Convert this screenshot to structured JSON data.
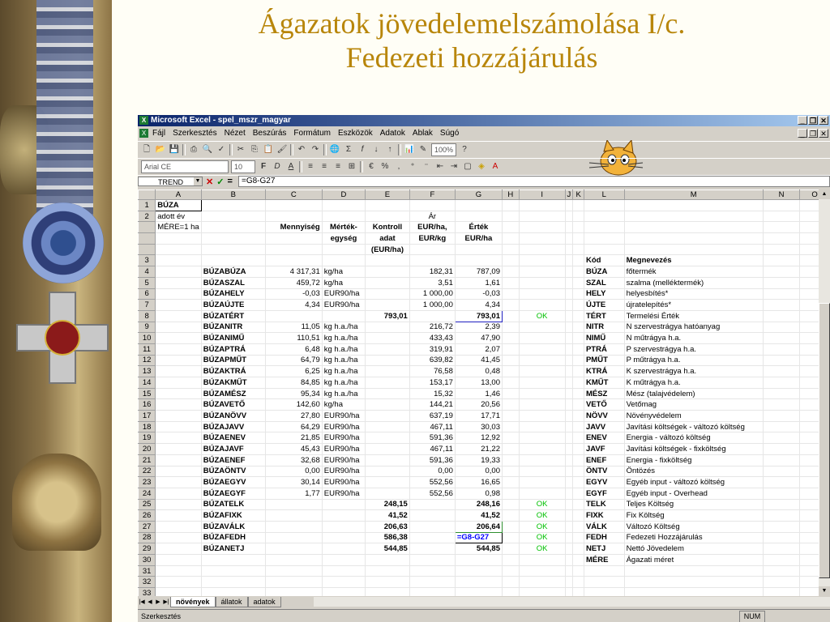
{
  "slide": {
    "title_line1": "Ágazatok jövedelemelszámolása I/c.",
    "title_line2": "Fedezeti hozzájárulás"
  },
  "window": {
    "title": "Microsoft Excel - spel_mszr_magyar",
    "minimize": "_",
    "restore": "❐",
    "close": "✕"
  },
  "menu": [
    "Fájl",
    "Szerkesztés",
    "Nézet",
    "Beszúrás",
    "Formátum",
    "Eszközök",
    "Adatok",
    "Ablak",
    "Súgó"
  ],
  "toolbar": {
    "zoom": "100%",
    "font_name": "Arial CE",
    "font_size": "10"
  },
  "formula_bar": {
    "name_box": "TREND",
    "formula": "=G8-G27"
  },
  "columns": [
    "A",
    "B",
    "C",
    "D",
    "E",
    "F",
    "G",
    "H",
    "I",
    "J",
    "K",
    "L",
    "M",
    "N",
    "O"
  ],
  "rows": [
    {
      "n": "1",
      "A": "BÚZA",
      "B": "",
      "C": "",
      "D": "",
      "E": "",
      "F": "",
      "G": "",
      "I": "",
      "L": "",
      "M": ""
    },
    {
      "n": "2",
      "A": "adott év",
      "B": "",
      "C": "",
      "D": "",
      "E": "",
      "F": "Ár",
      "G": "",
      "I": "",
      "L": "",
      "M": ""
    },
    {
      "n": "",
      "A": "MÉRE=1 ha",
      "B": "",
      "C": "Mennyiség",
      "D": "Mérték-",
      "E": "Kontroll",
      "F": "EUR/ha,",
      "G": "Érték",
      "I": "",
      "L": "",
      "M": ""
    },
    {
      "n": "",
      "A": "",
      "B": "",
      "C": "",
      "D": "egység",
      "E": "adat",
      "F": "EUR/kg",
      "G": "EUR/ha",
      "I": "",
      "L": "",
      "M": ""
    },
    {
      "n": "",
      "A": "",
      "B": "",
      "C": "",
      "D": "",
      "E": "(EUR/ha)",
      "F": "",
      "G": "",
      "I": "",
      "L": "",
      "M": ""
    },
    {
      "n": "3",
      "A": "",
      "B": "",
      "C": "",
      "D": "",
      "E": "",
      "F": "",
      "G": "",
      "I": "",
      "L": "Kód",
      "M": "Megnevezés"
    },
    {
      "n": "4",
      "A": "",
      "B": "BÚZABÚZA",
      "C": "4 317,31",
      "D": "kg/ha",
      "E": "",
      "F": "182,31",
      "G": "787,09",
      "I": "",
      "L": "BÚZA",
      "M": "főtermék"
    },
    {
      "n": "5",
      "A": "",
      "B": "BÚZASZAL",
      "C": "459,72",
      "D": "kg/ha",
      "E": "",
      "F": "3,51",
      "G": "1,61",
      "I": "",
      "L": "SZAL",
      "M": "szalma (melléktermék)"
    },
    {
      "n": "6",
      "A": "",
      "B": "BÚZAHELY",
      "C": "-0,03",
      "D": "EUR90/ha",
      "E": "",
      "F": "1 000,00",
      "G": "-0,03",
      "I": "",
      "L": "HELY",
      "M": "helyesbítés*"
    },
    {
      "n": "7",
      "A": "",
      "B": "BÚZAÚJTE",
      "C": "4,34",
      "D": "EUR90/ha",
      "E": "",
      "F": "1 000,00",
      "G": "4,34",
      "I": "",
      "L": "ÚJTE",
      "M": "újratelepítés*"
    },
    {
      "n": "8",
      "A": "",
      "B": "BÚZATÉRT",
      "C": "",
      "D": "",
      "E": "793,01",
      "F": "",
      "G": "793,01",
      "I": "OK",
      "L": "TÉRT",
      "M": "Termelési Érték"
    },
    {
      "n": "9",
      "A": "",
      "B": "BÚZANITR",
      "C": "11,05",
      "D": "kg h.a./ha",
      "E": "",
      "F": "216,72",
      "G": "2,39",
      "I": "",
      "L": "NITR",
      "M": "N szervestrágya hatóanyag"
    },
    {
      "n": "10",
      "A": "",
      "B": "BÚZANIMŰ",
      "C": "110,51",
      "D": "kg h.a./ha",
      "E": "",
      "F": "433,43",
      "G": "47,90",
      "I": "",
      "L": "NIMŰ",
      "M": "N műtrágya h.a."
    },
    {
      "n": "11",
      "A": "",
      "B": "BÚZAPTRÁ",
      "C": "6,48",
      "D": "kg h.a./ha",
      "E": "",
      "F": "319,91",
      "G": "2,07",
      "I": "",
      "L": "PTRÁ",
      "M": "P szervestrágya h.a."
    },
    {
      "n": "12",
      "A": "",
      "B": "BÚZAPMŰT",
      "C": "64,79",
      "D": "kg h.a./ha",
      "E": "",
      "F": "639,82",
      "G": "41,45",
      "I": "",
      "L": "PMŰT",
      "M": "P műtrágya h.a."
    },
    {
      "n": "13",
      "A": "",
      "B": "BÚZAKTRÁ",
      "C": "6,25",
      "D": "kg h.a./ha",
      "E": "",
      "F": "76,58",
      "G": "0,48",
      "I": "",
      "L": "KTRÁ",
      "M": "K szervestrágya h.a."
    },
    {
      "n": "14",
      "A": "",
      "B": "BÚZAKMŰT",
      "C": "84,85",
      "D": "kg h.a./ha",
      "E": "",
      "F": "153,17",
      "G": "13,00",
      "I": "",
      "L": "KMŰT",
      "M": "K műtrágya h.a."
    },
    {
      "n": "15",
      "A": "",
      "B": "BÚZAMÉSZ",
      "C": "95,34",
      "D": "kg h.a./ha",
      "E": "",
      "F": "15,32",
      "G": "1,46",
      "I": "",
      "L": "MÉSZ",
      "M": "Mész (talajvédelem)"
    },
    {
      "n": "16",
      "A": "",
      "B": "BÚZAVETŐ",
      "C": "142,60",
      "D": "kg/ha",
      "E": "",
      "F": "144,21",
      "G": "20,56",
      "I": "",
      "L": "VETŐ",
      "M": "Vetőmag"
    },
    {
      "n": "17",
      "A": "",
      "B": "BÚZANÖVV",
      "C": "27,80",
      "D": "EUR90/ha",
      "E": "",
      "F": "637,19",
      "G": "17,71",
      "I": "",
      "L": "NÖVV",
      "M": "Növényvédelem"
    },
    {
      "n": "18",
      "A": "",
      "B": "BÚZAJAVV",
      "C": "64,29",
      "D": "EUR90/ha",
      "E": "",
      "F": "467,11",
      "G": "30,03",
      "I": "",
      "L": "JAVV",
      "M": "Javítási költségek - változó költség"
    },
    {
      "n": "19",
      "A": "",
      "B": "BÚZAENEV",
      "C": "21,85",
      "D": "EUR90/ha",
      "E": "",
      "F": "591,36",
      "G": "12,92",
      "I": "",
      "L": "ENEV",
      "M": "Energia - változó költség"
    },
    {
      "n": "20",
      "A": "",
      "B": "BÚZAJAVF",
      "C": "45,43",
      "D": "EUR90/ha",
      "E": "",
      "F": "467,11",
      "G": "21,22",
      "I": "",
      "L": "JAVF",
      "M": "Javítási költségek - fixköltség"
    },
    {
      "n": "21",
      "A": "",
      "B": "BÚZAENEF",
      "C": "32,68",
      "D": "EUR90/ha",
      "E": "",
      "F": "591,36",
      "G": "19,33",
      "I": "",
      "L": "ENEF",
      "M": "Energia - fixköltség"
    },
    {
      "n": "22",
      "A": "",
      "B": "BÚZAÖNTV",
      "C": "0,00",
      "D": "EUR90/ha",
      "E": "",
      "F": "0,00",
      "G": "0,00",
      "I": "",
      "L": "ÖNTV",
      "M": "Öntözés"
    },
    {
      "n": "23",
      "A": "",
      "B": "BÚZAEGYV",
      "C": "30,14",
      "D": "EUR90/ha",
      "E": "",
      "F": "552,56",
      "G": "16,65",
      "I": "",
      "L": "EGYV",
      "M": "Egyéb input - változó költség"
    },
    {
      "n": "24",
      "A": "",
      "B": "BÚZAEGYF",
      "C": "1,77",
      "D": "EUR90/ha",
      "E": "",
      "F": "552,56",
      "G": "0,98",
      "I": "",
      "L": "EGYF",
      "M": "Egyéb input - Overhead"
    },
    {
      "n": "25",
      "A": "",
      "B": "BÚZATELK",
      "C": "",
      "D": "",
      "E": "248,15",
      "F": "",
      "G": "248,16",
      "I": "OK",
      "L": "TELK",
      "M": "Teljes Költség"
    },
    {
      "n": "26",
      "A": "",
      "B": "BÚZAFIXK",
      "C": "",
      "D": "",
      "E": "41,52",
      "F": "",
      "G": "41,52",
      "I": "OK",
      "L": "FIXK",
      "M": "Fix Költség"
    },
    {
      "n": "27",
      "A": "",
      "B": "BÚZAVÁLK",
      "C": "",
      "D": "",
      "E": "206,63",
      "F": "",
      "G": "206,64",
      "I": "OK",
      "L": "VÁLK",
      "M": "Változó Költség"
    },
    {
      "n": "28",
      "A": "",
      "B": "BÚZAFEDH",
      "C": "",
      "D": "",
      "E": "586,38",
      "F": "",
      "G": "=G8-G27",
      "I": "OK",
      "L": "FEDH",
      "M": "Fedezeti Hozzájárulás"
    },
    {
      "n": "29",
      "A": "",
      "B": "BÚZANETJ",
      "C": "",
      "D": "",
      "E": "544,85",
      "F": "",
      "G": "544,85",
      "I": "OK",
      "L": "NETJ",
      "M": "Nettó Jövedelem"
    },
    {
      "n": "30",
      "A": "",
      "B": "",
      "C": "",
      "D": "",
      "E": "",
      "F": "",
      "G": "",
      "I": "",
      "L": "MÉRE",
      "M": "Ágazati méret"
    },
    {
      "n": "31",
      "A": "",
      "B": "",
      "C": "",
      "D": "",
      "E": "",
      "F": "",
      "G": "",
      "I": "",
      "L": "",
      "M": ""
    },
    {
      "n": "32",
      "A": "",
      "B": "",
      "C": "",
      "D": "",
      "E": "",
      "F": "",
      "G": "",
      "I": "",
      "L": "",
      "M": ""
    },
    {
      "n": "33",
      "A": "",
      "B": "",
      "C": "",
      "D": "",
      "E": "",
      "F": "",
      "G": "",
      "I": "",
      "L": "",
      "M": ""
    }
  ],
  "sheet_tabs": [
    "növények",
    "állatok",
    "adatok"
  ],
  "status": {
    "mode": "Szerkesztés",
    "num": "NUM"
  }
}
